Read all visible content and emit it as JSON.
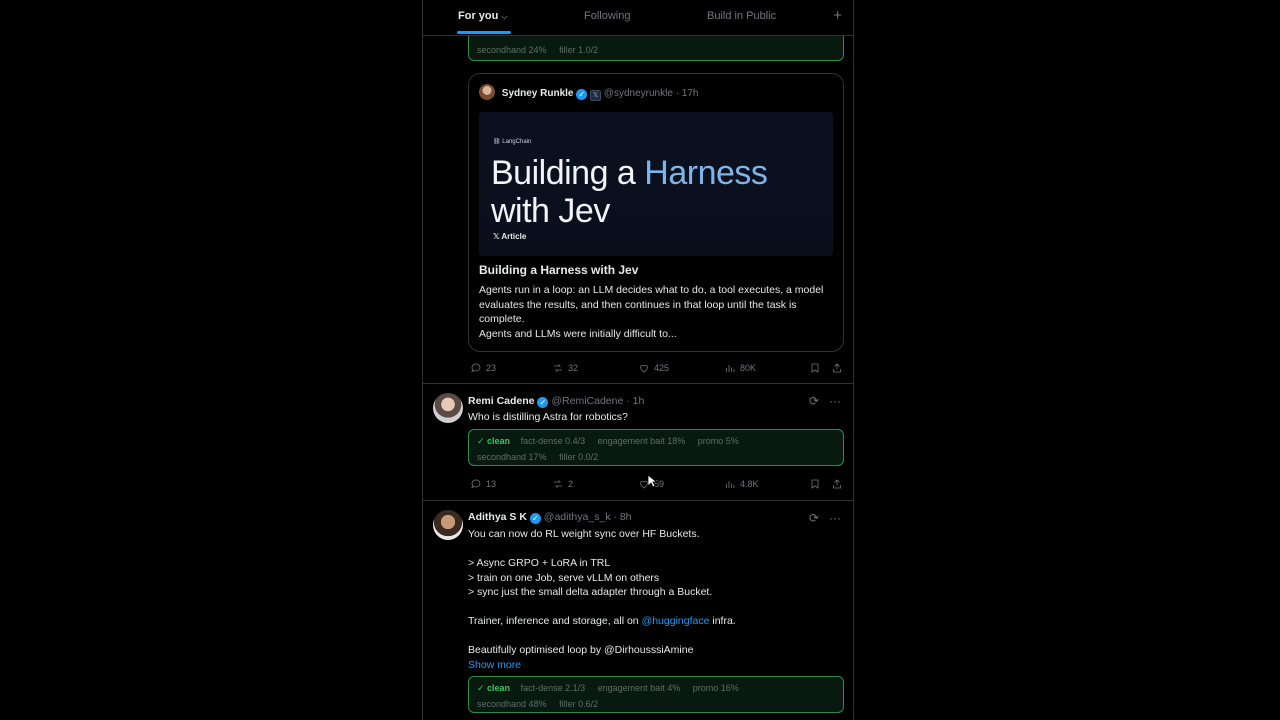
{
  "tabs": {
    "for_you": "For you",
    "following": "Following",
    "build_in_public": "Build in Public",
    "add": "+"
  },
  "top_classifier": {
    "secondhand": "secondhand 24%",
    "filler": "filler 1.0/2"
  },
  "quote": {
    "author_name": "Sydney Runkle",
    "handle": "@sydneyrunkle",
    "time": "· 17h",
    "image": {
      "brand": "LangChain",
      "headline_a": "Building a ",
      "headline_b": "Harness",
      "headline_c": "with Jev",
      "tag": "Article"
    },
    "article_title": "Building a Harness with Jev",
    "article_body": "Agents run in a loop: an LLM decides what to do, a tool executes, a model evaluates the results, and then continues in that loop until the task is complete.",
    "article_body_2": "Agents and LLMs were initially difficult to..."
  },
  "post1_actions": {
    "replies": "23",
    "reposts": "32",
    "likes": "425",
    "views": "80K"
  },
  "post2": {
    "name": "Remi Cadene",
    "handle": "@RemiCadene",
    "time": "· 1h",
    "text": "Who is distilling Astra for robotics?",
    "classifier": {
      "status": "✓ clean",
      "fact": "fact-dense 0.4/3",
      "bait": "engagement bait 18%",
      "promo": "promo 5%",
      "secondhand": "secondhand 17%",
      "filler": "filler 0.0/2"
    },
    "actions": {
      "replies": "13",
      "reposts": "2",
      "likes": "59",
      "views": "4.8K"
    }
  },
  "post3": {
    "name": "Adithya S K",
    "handle": "@adithya_s_k",
    "time": "· 8h",
    "line1": "You can now do RL weight sync over HF Buckets.",
    "line2": "> Async GRPO + LoRA in TRL",
    "line3": "> train on one Job, serve vLLM on others",
    "line4": "> sync just the small delta adapter through a Bucket.",
    "line5_a": "Trainer, inference and storage, all on ",
    "line5_mention": "@huggingface",
    "line5_b": " infra.",
    "line6": "Beautifully optimised loop by @DirhousssiAmine",
    "show_more": "Show more",
    "classifier": {
      "status": "✓ clean",
      "fact": "fact-dense 2.1/3",
      "bait": "engagement bait 4%",
      "promo": "promo 16%",
      "secondhand": "secondhand 48%",
      "filler": "filler 0.6/2"
    }
  },
  "icons": {
    "more": "···",
    "grok": "grok-icon"
  },
  "colors": {
    "accent": "#1d9bf0",
    "clean": "#39c45e",
    "bg": "#000000"
  }
}
